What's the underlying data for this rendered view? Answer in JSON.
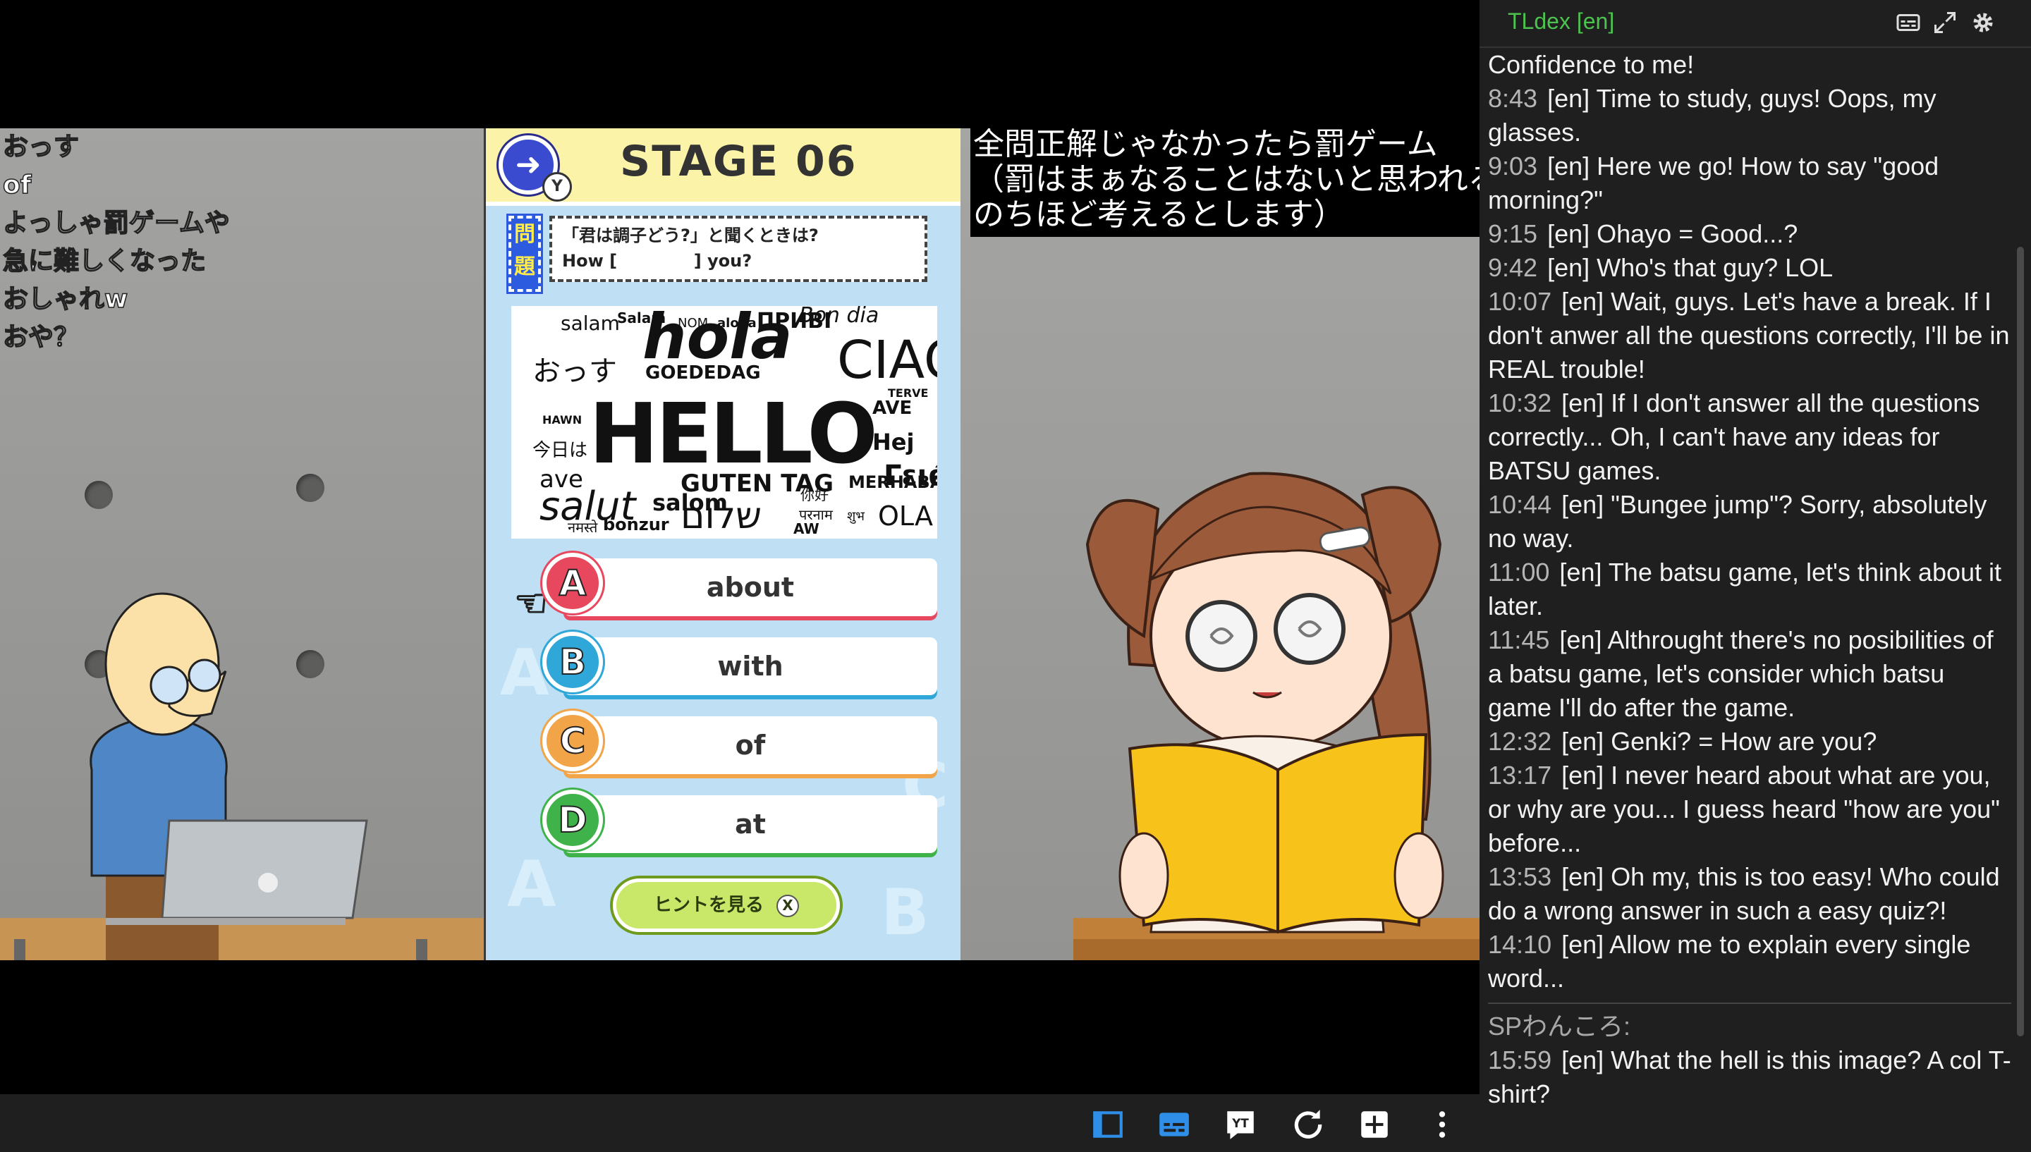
{
  "nico_comments": [
    "おっす",
    "of",
    "よっしゃ罰ゲームや",
    "急に難しくなった",
    "おしゃれw",
    "おや？"
  ],
  "game": {
    "stage_title": "STAGE 06",
    "back_badge": "Y",
    "mondai_label": "問題",
    "question_line1": "「君は調子どう?」と聞くときは?",
    "question_line2": "How [             ] you?",
    "word_cloud": [
      "HELLO",
      "hola",
      "CIAO",
      "salam",
      "GUTEN TAG",
      "GOEDEDAG",
      "おっす",
      "Salam",
      "ave",
      "salut",
      "bonzur",
      "AVE",
      "Hej",
      "Bon dia",
      "今日は",
      "HAWN",
      "ПРИВІ",
      "Γειά!",
      "שלום",
      "MERHABA",
      "OLA",
      "aloha",
      "NOM",
      "TERVE",
      "नमस्ते",
      "शुभ",
      "你好",
      "AW",
      "salom",
      "परनाम"
    ],
    "options": [
      {
        "letter": "A",
        "text": "about",
        "color": "#e8485e"
      },
      {
        "letter": "B",
        "text": "with",
        "color": "#2fa7d8"
      },
      {
        "letter": "C",
        "text": "of",
        "color": "#f2a448"
      },
      {
        "letter": "D",
        "text": "at",
        "color": "#3fb34a"
      }
    ],
    "hint_label": "ヒントを見る",
    "hint_key": "X"
  },
  "announcement": {
    "line1": "全問正解じゃなかったら罰ゲーム",
    "line2": "（罰はまぁなることはないと思われるので",
    "line3": "のちほど考えるとします）"
  },
  "chat": {
    "title": "TLdex [en]",
    "messages": [
      {
        "ts": "",
        "text": "Confidence to me!"
      },
      {
        "ts": "8:43",
        "text": "[en] Time to study, guys! Oops, my glasses."
      },
      {
        "ts": "9:03",
        "text": "[en] Here we go! How to say \"good morning?\""
      },
      {
        "ts": "9:15",
        "text": "[en] Ohayo = Good...?"
      },
      {
        "ts": "9:42",
        "text": "[en] Who's that guy? LOL"
      },
      {
        "ts": "10:07",
        "text": "[en] Wait, guys. Let's have a break. If I don't anwer all the questions correctly, I'll be in REAL trouble!"
      },
      {
        "ts": "10:32",
        "text": "[en] If I don't answer all the questions correctly... Oh, I can't have any ideas for BATSU games."
      },
      {
        "ts": "10:44",
        "text": "[en] \"Bungee jump\"? Sorry, absolutely no way."
      },
      {
        "ts": "11:00",
        "text": "[en] The batsu game, let's think about it later."
      },
      {
        "ts": "11:45",
        "text": "[en] Althrought there's no posibilities of a batsu game, let's consider which batsu game I'll do after the game."
      },
      {
        "ts": "12:32",
        "text": "[en] Genki? = How are you?"
      },
      {
        "ts": "13:17",
        "text": "[en] I never heard about what are you, or why are you... I guess heard \"how are you\" before..."
      },
      {
        "ts": "13:53",
        "text": "[en] Oh my, this is too easy! Who could do a wrong answer in such a easy quiz?!"
      },
      {
        "ts": "14:10",
        "text": "[en] Allow me to explain every single word..."
      }
    ],
    "second_author": "SPわんころ:",
    "second_messages": [
      {
        "ts": "15:59",
        "text": "[en] What the hell is this image? A col T-shirt?"
      }
    ]
  },
  "toolbar": {
    "icons": [
      "layout-icon",
      "subtitles-icon",
      "youtube-icon",
      "refresh-icon",
      "add-icon",
      "more-icon"
    ],
    "accent": "#2f8fe8"
  }
}
